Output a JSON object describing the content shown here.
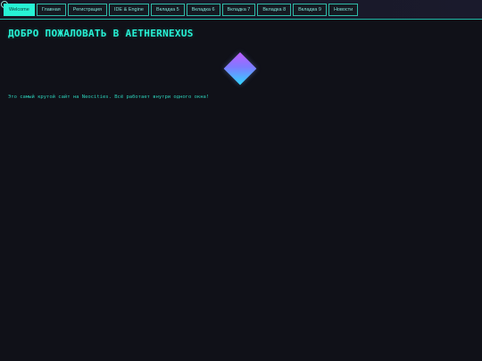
{
  "nav": {
    "tabs": [
      {
        "label": "Welcome",
        "active": true
      },
      {
        "label": "Главная"
      },
      {
        "label": "Регистрация"
      },
      {
        "label": "IDE & Engine"
      },
      {
        "label": "Вкладка 5"
      },
      {
        "label": "Вкладка 6"
      },
      {
        "label": "Вкладка 7"
      },
      {
        "label": "Вкладка 8"
      },
      {
        "label": "Вкладка 9"
      },
      {
        "label": "Новости"
      }
    ]
  },
  "main": {
    "title": "ДОБРО ПОЖАЛОВАТЬ В AETHERNEXUS",
    "subtitle": "Это самый крутой сайт на Neocities. Всё работает внутри одного окна!"
  },
  "colors": {
    "accent": "#27f2d5",
    "background": "#101118",
    "tab_border": "#2fb9a6"
  },
  "icons": {
    "logo": "diamond-logo-icon"
  }
}
